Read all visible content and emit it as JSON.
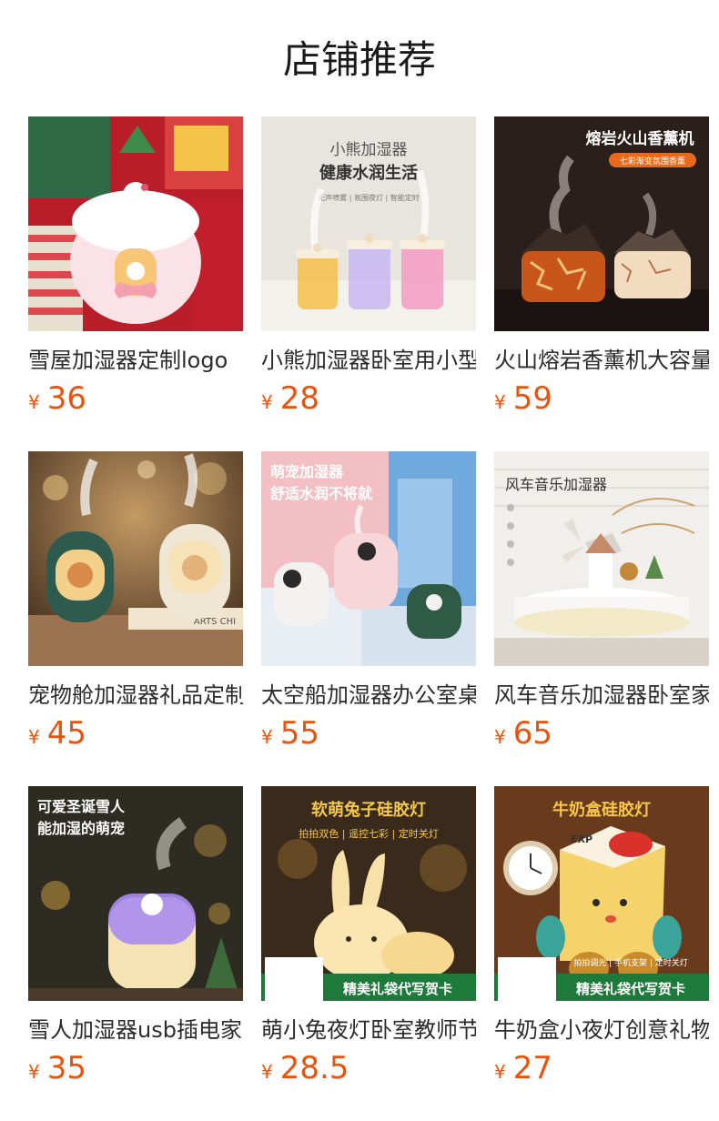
{
  "page": {
    "title": "店铺推荐"
  },
  "currency": "¥",
  "products": [
    {
      "name": "雪屋加湿器定制logo",
      "price": "36",
      "image": {
        "subject": "snow-house-humidifier",
        "caption": "",
        "tagline": "",
        "banner": "",
        "colors": [
          "#c8202a",
          "#f6d8dc",
          "#2f6b45"
        ]
      }
    },
    {
      "name": "小熊加湿器卧室用小型",
      "price": "28",
      "image": {
        "subject": "bear-humidifiers",
        "caption": "小熊加湿器",
        "tagline": "健康水润生活",
        "subtag": "无声喷雾 | 氛围夜灯 | 智能定时",
        "banner": "",
        "colors": [
          "#e9e4dc",
          "#f2c64a",
          "#f29bb8"
        ]
      }
    },
    {
      "name": "火山熔岩香薰机大容量",
      "price": "59",
      "image": {
        "subject": "volcano-aroma-diffuser",
        "caption": "熔岩火山香薰机",
        "tagline": "七彩渐变氛围香薰",
        "banner": "",
        "colors": [
          "#2a1e1a",
          "#e86a1a",
          "#f2c27a"
        ]
      }
    },
    {
      "name": "宠物舱加湿器礼品定制",
      "price": "45",
      "image": {
        "subject": "pet-capsule-humidifiers",
        "caption": "",
        "tagline": "",
        "book": "ARTS CHI",
        "banner": "",
        "colors": [
          "#7a5a3a",
          "#2f5a4e",
          "#efe6d4"
        ]
      }
    },
    {
      "name": "太空船加湿器办公室桌面",
      "price": "55",
      "image": {
        "subject": "spaceship-humidifiers",
        "caption": "萌宠加湿器",
        "tagline": "舒适水润不将就",
        "banner": "",
        "colors": [
          "#f2bcc2",
          "#6fa9dd",
          "#2e5a46"
        ]
      }
    },
    {
      "name": "风车音乐加湿器卧室家用",
      "price": "65",
      "image": {
        "subject": "windmill-music-humidifier",
        "caption": "风车音乐加湿器",
        "tagline": "",
        "banner": "",
        "colors": [
          "#f3f1ee",
          "#e7d9c4",
          "#caa46a"
        ]
      }
    },
    {
      "name": "雪人加湿器usb插电家用",
      "price": "35",
      "image": {
        "subject": "snowman-humidifier",
        "caption": "可爱圣诞雪人",
        "tagline": "能加湿的萌宠",
        "banner": "",
        "colors": [
          "#2a2a22",
          "#a88cf0",
          "#f5e3b4"
        ]
      }
    },
    {
      "name": "萌小兔夜灯卧室教师节",
      "price": "28.5",
      "image": {
        "subject": "bunny-silicone-lamp",
        "caption": "软萌兔子硅胶灯",
        "tagline": "拍拍双色 | 遥控七彩 | 定时关灯",
        "banner": "精美礼袋代写贺卡",
        "colors": [
          "#3a2a1a",
          "#f6d48a",
          "#e8a23a"
        ]
      }
    },
    {
      "name": "牛奶盒小夜灯创意礼物",
      "price": "27",
      "image": {
        "subject": "milk-box-silicone-lamp",
        "caption": "牛奶盒硅胶灯",
        "tagline": "拍拍调光 | 手机支架 | 定时关灯",
        "banner": "精美礼袋代写贺卡",
        "box": "EXP",
        "colors": [
          "#6a3a1a",
          "#f6c53a",
          "#d9322a"
        ]
      }
    }
  ]
}
